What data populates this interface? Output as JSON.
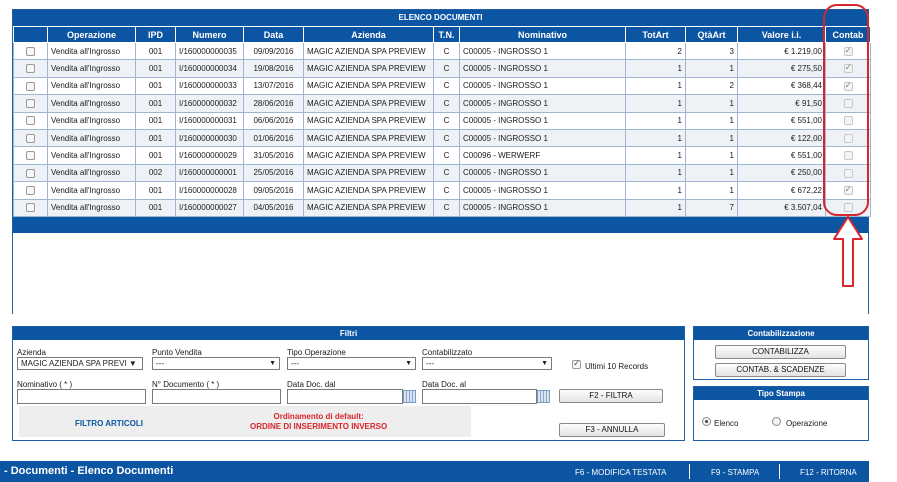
{
  "document_list": {
    "title": "ELENCO DOCUMENTI",
    "columns": [
      "",
      "Operazione",
      "IPD",
      "Numero",
      "Data",
      "Azienda",
      "T.N.",
      "Nominativo",
      "TotArt",
      "QtàArt",
      "Valore i.i.",
      "Contab"
    ],
    "rows": [
      {
        "selected": false,
        "operazione": "Vendita all'Ingrosso",
        "ipd": "001",
        "numero": "I/160000000035",
        "data": "09/09/2016",
        "azienda": "MAGIC AZIENDA SPA PREVIEW",
        "tn": "C",
        "nominativo": "C00005 - INGROSSO 1",
        "totart": "2",
        "qtaart": "3",
        "valore": "€ 1.219,00",
        "contab": true
      },
      {
        "selected": false,
        "operazione": "Vendita all'Ingrosso",
        "ipd": "001",
        "numero": "I/160000000034",
        "data": "19/08/2016",
        "azienda": "MAGIC AZIENDA SPA PREVIEW",
        "tn": "C",
        "nominativo": "C00005 - INGROSSO 1",
        "totart": "1",
        "qtaart": "1",
        "valore": "€ 275,50",
        "contab": true
      },
      {
        "selected": false,
        "operazione": "Vendita all'Ingrosso",
        "ipd": "001",
        "numero": "I/160000000033",
        "data": "13/07/2016",
        "azienda": "MAGIC AZIENDA SPA PREVIEW",
        "tn": "C",
        "nominativo": "C00005 - INGROSSO 1",
        "totart": "1",
        "qtaart": "2",
        "valore": "€ 368,44",
        "contab": true
      },
      {
        "selected": false,
        "operazione": "Vendita all'Ingrosso",
        "ipd": "001",
        "numero": "I/160000000032",
        "data": "28/06/2016",
        "azienda": "MAGIC AZIENDA SPA PREVIEW",
        "tn": "C",
        "nominativo": "C00005 - INGROSSO 1",
        "totart": "1",
        "qtaart": "1",
        "valore": "€ 91,50",
        "contab": false
      },
      {
        "selected": false,
        "operazione": "Vendita all'Ingrosso",
        "ipd": "001",
        "numero": "I/160000000031",
        "data": "06/06/2016",
        "azienda": "MAGIC AZIENDA SPA PREVIEW",
        "tn": "C",
        "nominativo": "C00005 - INGROSSO 1",
        "totart": "1",
        "qtaart": "1",
        "valore": "€ 551,00",
        "contab": false
      },
      {
        "selected": false,
        "operazione": "Vendita all'Ingrosso",
        "ipd": "001",
        "numero": "I/160000000030",
        "data": "01/06/2016",
        "azienda": "MAGIC AZIENDA SPA PREVIEW",
        "tn": "C",
        "nominativo": "C00005 - INGROSSO 1",
        "totart": "1",
        "qtaart": "1",
        "valore": "€ 122,00",
        "contab": false
      },
      {
        "selected": false,
        "operazione": "Vendita all'Ingrosso",
        "ipd": "001",
        "numero": "I/160000000029",
        "data": "31/05/2016",
        "azienda": "MAGIC AZIENDA SPA PREVIEW",
        "tn": "C",
        "nominativo": "C00096 - WERWERF",
        "totart": "1",
        "qtaart": "1",
        "valore": "€ 551,00",
        "contab": false
      },
      {
        "selected": false,
        "operazione": "Vendita all'Ingrosso",
        "ipd": "002",
        "numero": "I/160000000001",
        "data": "25/05/2016",
        "azienda": "MAGIC AZIENDA SPA PREVIEW",
        "tn": "C",
        "nominativo": "C00005 - INGROSSO 1",
        "totart": "1",
        "qtaart": "1",
        "valore": "€ 250,00",
        "contab": false
      },
      {
        "selected": false,
        "operazione": "Vendita all'Ingrosso",
        "ipd": "001",
        "numero": "I/160000000028",
        "data": "09/05/2016",
        "azienda": "MAGIC AZIENDA SPA PREVIEW",
        "tn": "C",
        "nominativo": "C00005 - INGROSSO 1",
        "totart": "1",
        "qtaart": "1",
        "valore": "€ 672,22",
        "contab": true
      },
      {
        "selected": false,
        "operazione": "Vendita all'Ingrosso",
        "ipd": "001",
        "numero": "I/160000000027",
        "data": "04/05/2016",
        "azienda": "MAGIC AZIENDA SPA PREVIEW",
        "tn": "C",
        "nominativo": "C00005 - INGROSSO 1",
        "totart": "1",
        "qtaart": "7",
        "valore": "€ 3.507,04",
        "contab": false
      }
    ]
  },
  "filters": {
    "title": "Filtri",
    "azienda_label": "Azienda",
    "azienda_value": "MAGIC AZIENDA SPA PREVI ▼",
    "punto_vendita_label": "Punto Vendita",
    "punto_vendita_value": "---",
    "tipo_operazione_label": "Tipo Operazione",
    "tipo_operazione_value": "---",
    "contabilizzato_label": "Contabilizzato",
    "contabilizzato_value": "---",
    "ultimi_label": "Ultimi 10 Records",
    "ultimi_checked": true,
    "nominativo_label": "Nominativo ( * )",
    "numero_label": "N° Documento ( * )",
    "data_dal_label": "Data Doc. dal",
    "data_al_label": "Data Doc. al",
    "filtra_button": "F2 - FILTRA",
    "annulla_button": "F3 - ANNULLA",
    "filtro_articoli": "FILTRO ARTICOLI",
    "sort_line1": "Ordinamento di default:",
    "sort_line2": "ORDINE DI INSERIMENTO INVERSO"
  },
  "contabilizzazione": {
    "title": "Contabilizzazione",
    "contabilizza_button": "CONTABILIZZA",
    "contab_scadenze_button": "CONTAB. & SCADENZE"
  },
  "tipo_stampa": {
    "title": "Tipo Stampa",
    "options": [
      {
        "label": "Elenco",
        "selected": true
      },
      {
        "label": "Operazione",
        "selected": false
      }
    ]
  },
  "statusbar": {
    "title": "- Documenti - Elenco Documenti",
    "f6": "F6 - MODIFICA TESTATA",
    "f9": "F9 - STAMPA",
    "f12": "F12 - RITORNA"
  },
  "colors": {
    "header_blue": "#0c55a3",
    "highlight_red": "#d7262d"
  }
}
